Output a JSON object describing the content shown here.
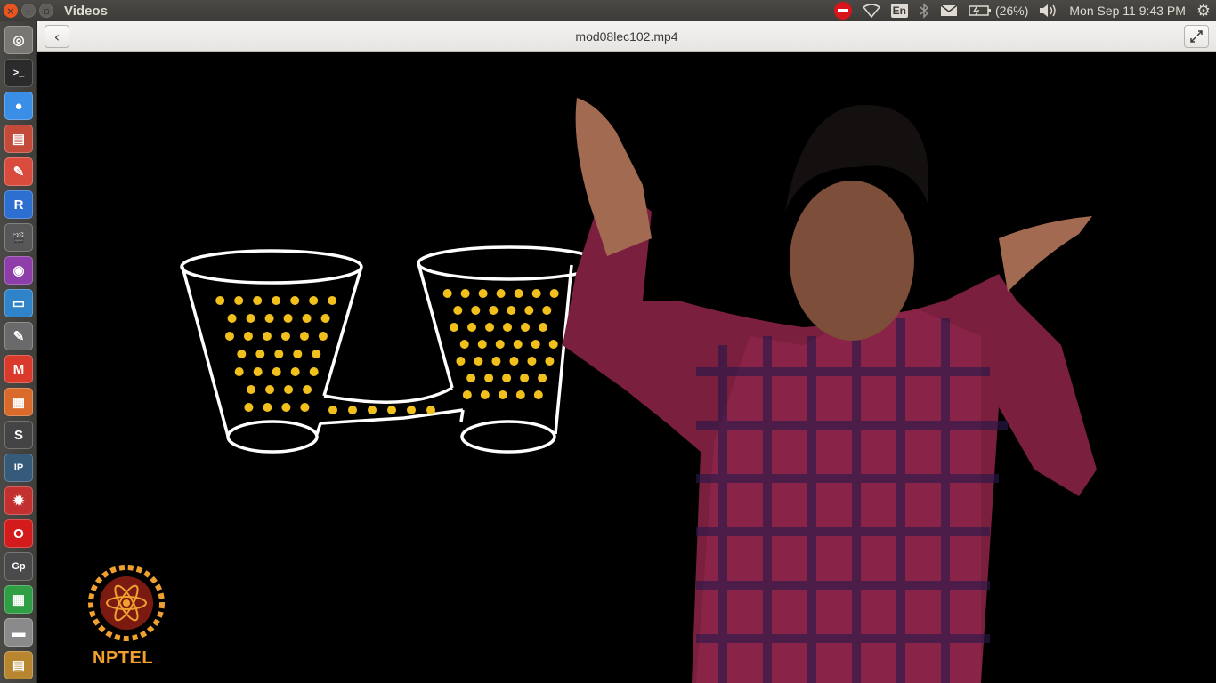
{
  "window": {
    "app_title": "Videos",
    "close_icon": "close-icon",
    "minimize_icon": "minimize-icon",
    "maximize_icon": "maximize-icon"
  },
  "tray": {
    "language": "En",
    "battery": "(26%)",
    "datetime": "Mon Sep 11  9:43 PM",
    "icons": [
      "no-entry-icon",
      "wifi-icon",
      "keyboard-layout-icon",
      "bluetooth-icon",
      "mail-icon",
      "battery-icon",
      "volume-icon",
      "gear-icon"
    ]
  },
  "launcher": {
    "items": [
      {
        "name": "ubuntu-dash",
        "glyph": "◎",
        "color": "#7a7772"
      },
      {
        "name": "terminal",
        "glyph": ">_",
        "color": "#2b2b2b"
      },
      {
        "name": "chrome",
        "glyph": "●",
        "color": "#3b8ee6"
      },
      {
        "name": "files-archive",
        "glyph": "▤",
        "color": "#c44a3a"
      },
      {
        "name": "document-viewer",
        "glyph": "✎",
        "color": "#d94c3d"
      },
      {
        "name": "r-studio",
        "glyph": "R",
        "color": "#2d6fd0"
      },
      {
        "name": "video-editor",
        "glyph": "🎬",
        "color": "#575757"
      },
      {
        "name": "screen-recorder",
        "glyph": "◉",
        "color": "#8e3ea8"
      },
      {
        "name": "libreoffice-writer",
        "glyph": "▭",
        "color": "#2f83c9"
      },
      {
        "name": "text-editor",
        "glyph": "✎",
        "color": "#6a6a6a"
      },
      {
        "name": "gmail",
        "glyph": "M",
        "color": "#d93a2b"
      },
      {
        "name": "libreoffice-impress",
        "glyph": "▦",
        "color": "#d96a2b"
      },
      {
        "name": "sublime-text",
        "glyph": "S",
        "color": "#444444"
      },
      {
        "name": "ipython",
        "glyph": "IP",
        "color": "#355a7a"
      },
      {
        "name": "settings-cog",
        "glyph": "✹",
        "color": "#c23030"
      },
      {
        "name": "opera",
        "glyph": "O",
        "color": "#d31b1b"
      },
      {
        "name": "gp-app",
        "glyph": "Gp",
        "color": "#4a4a4a"
      },
      {
        "name": "libreoffice-calc",
        "glyph": "▦",
        "color": "#2f9e44"
      },
      {
        "name": "drive",
        "glyph": "▬",
        "color": "#8a8a8a"
      },
      {
        "name": "archive-manager",
        "glyph": "▤",
        "color": "#b8862e"
      }
    ]
  },
  "header": {
    "back_icon": "back-arrow-icon",
    "file_title": "mod08lec102.mp4",
    "fullscreen_icon": "fullscreen-icon"
  },
  "video": {
    "logo_text": "NPTEL",
    "drawing_color": "#ffffff",
    "particle_color": "#f2c01c",
    "logo_color": "#f0a030"
  }
}
